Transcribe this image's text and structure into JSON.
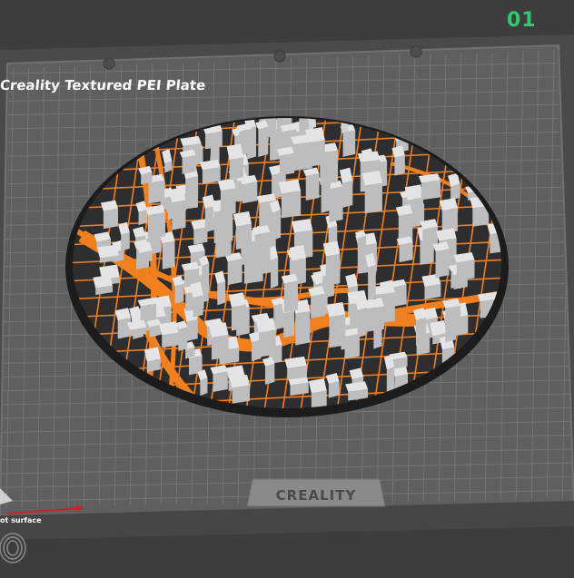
{
  "plate": {
    "number": "01",
    "title": "Creality Textured PEI Plate",
    "brand": "CREALITY",
    "surface_label": "ot surface"
  },
  "model": {
    "name": "city-map-disc",
    "base_color": "#2c2c2e",
    "road_color": "#f07f1e",
    "building_color": "#e4e4e6"
  },
  "colors": {
    "background": "#3d3d3f",
    "plate": "#626264",
    "grid": "#7a7a7c",
    "accent_green": "#2ecc71",
    "axis_red": "#cc2222"
  },
  "icons": {
    "fingerprint": "fingerprint-icon",
    "axis": "axis-arrow-icon",
    "corner": "corner-triangle-icon"
  }
}
